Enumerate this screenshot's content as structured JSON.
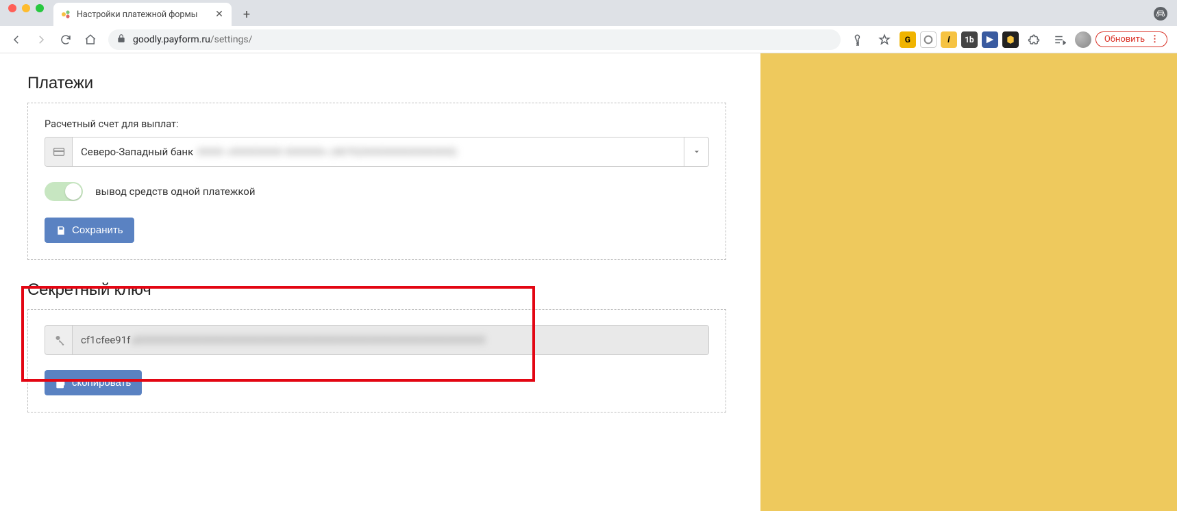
{
  "browser": {
    "tab_title": "Настройки платежной формы",
    "url_host": "goodly.payform.ru",
    "url_path": "/settings/",
    "update_label": "Обновить"
  },
  "payments": {
    "heading": "Платежи",
    "account_label": "Расчетный счет для выплат:",
    "account_value_visible": "Северо-Западный банк",
    "account_value_hidden": "XXXX «XXXXXXXX XXXXXX» (40702XXXXXXXXXXXXXX)",
    "toggle_label": "вывод средств одной платежкой",
    "toggle_on": true,
    "save_label": "Сохранить"
  },
  "secret": {
    "heading": "Секретный ключ",
    "value_visible": "cf1cfee91f",
    "value_hidden": "aXXXXXXXXXXXXXXXXXXXXXXXXXXXXXXXXXXXXXXXXXXXXXXXXXXXXXX",
    "copy_label": "скопировать"
  },
  "colors": {
    "sidebar_yellow": "#eec95d",
    "primary_button": "#5a82c2",
    "highlight_red": "#e30613"
  }
}
